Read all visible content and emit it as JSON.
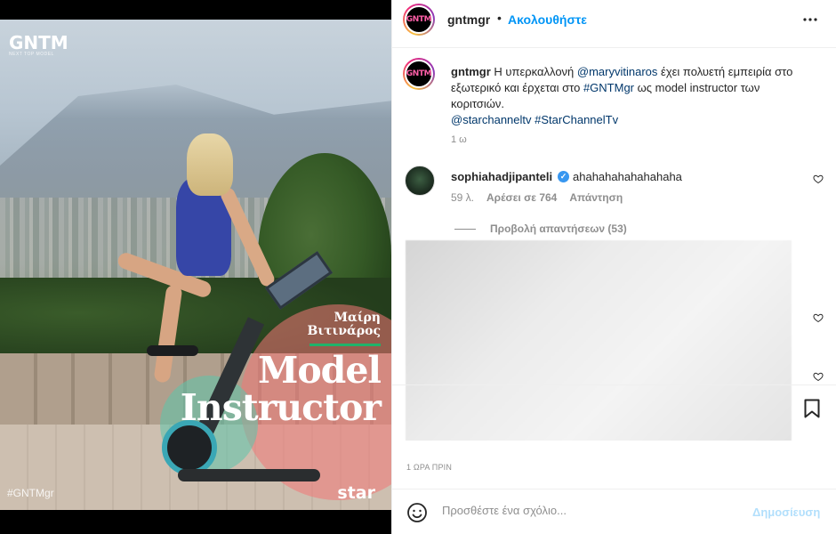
{
  "media": {
    "brand_logo": "GNTM",
    "brand_sub": "NEXT TOP MODEL",
    "name_line1": "Μαίρη",
    "name_line2": "Βιτινάρος",
    "headline_line1": "Model",
    "headline_line2": "Instructor",
    "hashtag": "#GNTMgr",
    "channel_logo": "star"
  },
  "header": {
    "avatar_text": "GNTM",
    "username": "gntmgr",
    "separator": "•",
    "follow_label": "Ακολουθήστε",
    "more_icon": "more-horizontal-icon"
  },
  "caption": {
    "username": "gntmgr",
    "text_1": " Η υπερκαλλονή ",
    "mention_1": "@maryvitinaros",
    "text_2": " έχει πολυετή εμπειρία στο εξωτερικό και έρχεται στο ",
    "hashtag_1": "#GNTMgr",
    "text_3": " ως model instructor των κοριτσιών.",
    "mention_2": "@starchanneltv",
    "hashtag_2": "#StarChannelTv",
    "time": "1 ω"
  },
  "comment": {
    "username": "sophiahadjipanteli",
    "verified_icon": "✓",
    "text": "ahahahahahahahaha",
    "age": "59 λ.",
    "likes": "Αρέσει σε 764",
    "reply": "Απάντηση",
    "view_replies": "Προβολή απαντήσεων (53)"
  },
  "footer": {
    "timestamp": "1 ΩΡΑ ΠΡΙΝ"
  },
  "composer": {
    "placeholder": "Προσθέστε ένα σχόλιο...",
    "post_label": "Δημοσίευση"
  },
  "colors": {
    "accent": "#0095f6",
    "link": "#00376b",
    "muted": "#8e8e8e",
    "post_disabled": "#b2dffc"
  }
}
